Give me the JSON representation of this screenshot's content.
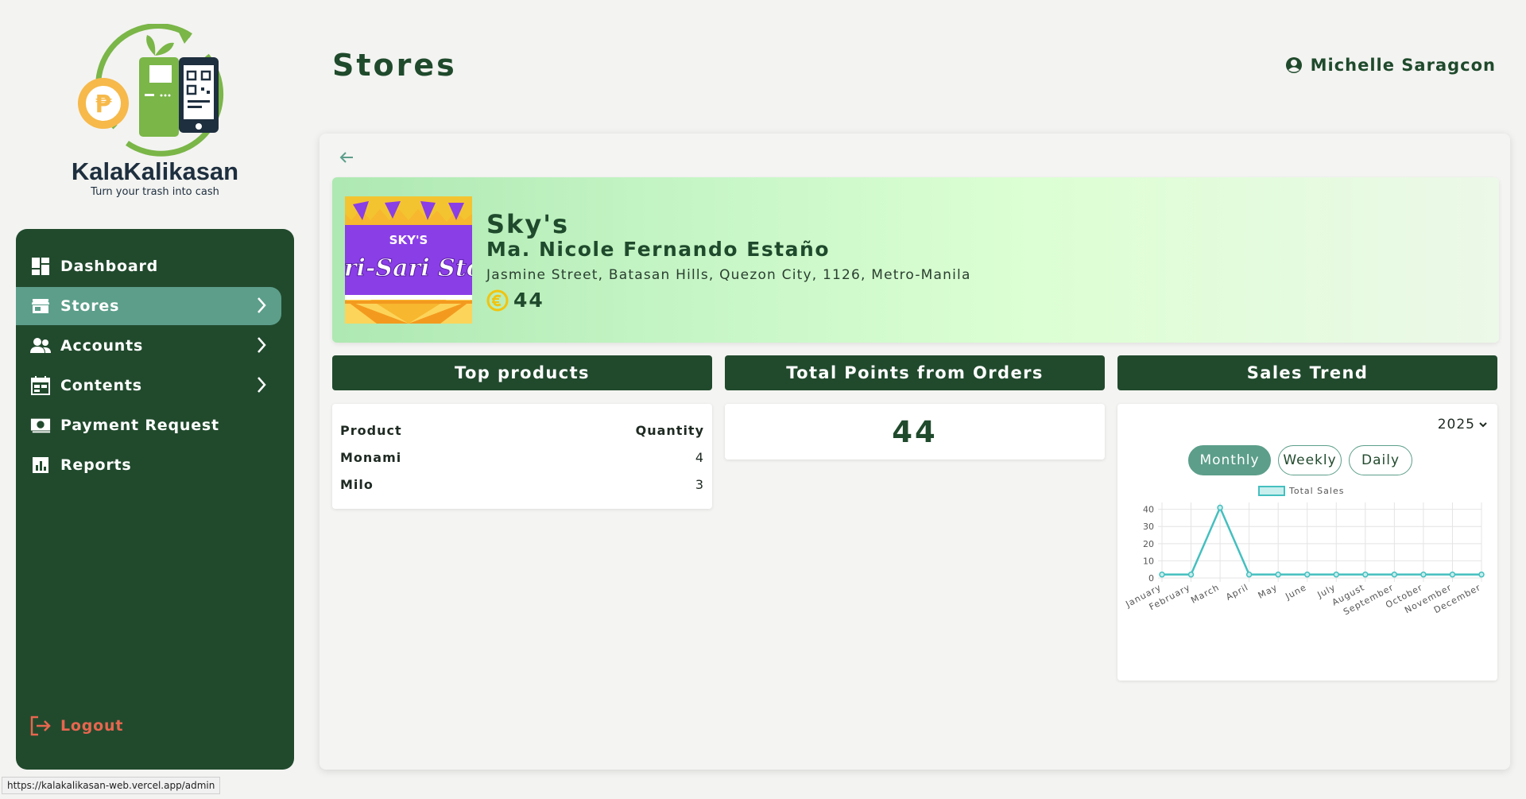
{
  "brand": {
    "name": "KalaKalikasan",
    "tagline": "Turn your trash into cash"
  },
  "sidebar": {
    "items": [
      {
        "label": "Dashboard",
        "icon": "dashboard-icon",
        "has_chevron": false
      },
      {
        "label": "Stores",
        "icon": "store-icon",
        "has_chevron": true,
        "active": true
      },
      {
        "label": "Accounts",
        "icon": "users-icon",
        "has_chevron": true
      },
      {
        "label": "Contents",
        "icon": "calendar-icon",
        "has_chevron": true
      },
      {
        "label": "Payment Request",
        "icon": "money-icon",
        "has_chevron": false
      },
      {
        "label": "Reports",
        "icon": "chart-icon",
        "has_chevron": false
      }
    ],
    "logout_label": "Logout"
  },
  "header": {
    "title": "Stores",
    "user_name": "Michelle Saragcon"
  },
  "store": {
    "image_text_top": "SKY'S",
    "image_text_main": "ari-Sari Sto",
    "name": "Sky's",
    "owner": "Ma. Nicole Fernando Estaño",
    "address": "Jasmine Street, Batasan Hills, Quezon City, 1126, Metro-Manila",
    "points": "44"
  },
  "cards": {
    "top_products": {
      "title": "Top products",
      "columns": [
        "Product",
        "Quantity"
      ],
      "rows": [
        {
          "product": "Monami",
          "quantity": "4"
        },
        {
          "product": "Milo",
          "quantity": "3"
        }
      ]
    },
    "total_points": {
      "title": "Total Points from Orders",
      "value": "44"
    },
    "sales_trend": {
      "title": "Sales Trend",
      "year": "2025",
      "tabs": [
        "Monthly",
        "Weekly",
        "Daily"
      ],
      "active_tab": "Monthly"
    }
  },
  "chart_data": {
    "type": "line",
    "categories": [
      "January",
      "February",
      "March",
      "April",
      "May",
      "June",
      "July",
      "August",
      "September",
      "October",
      "November",
      "December"
    ],
    "series": [
      {
        "name": "Total Sales",
        "values": [
          2,
          2,
          41,
          2,
          2,
          2,
          2,
          2,
          2,
          2,
          2,
          2
        ],
        "color": "#45bfbf"
      }
    ],
    "yticks": [
      0,
      10,
      20,
      30,
      40
    ],
    "ylim": [
      0,
      44
    ],
    "grid": true,
    "legend": "top"
  },
  "status_bar": {
    "url": "https://kalakalikasan-web.vercel.app/admin"
  },
  "colors": {
    "primary": "#214a2d",
    "accent": "#5c9e8a",
    "logout": "#e8664f",
    "line": "#45bfbf"
  }
}
